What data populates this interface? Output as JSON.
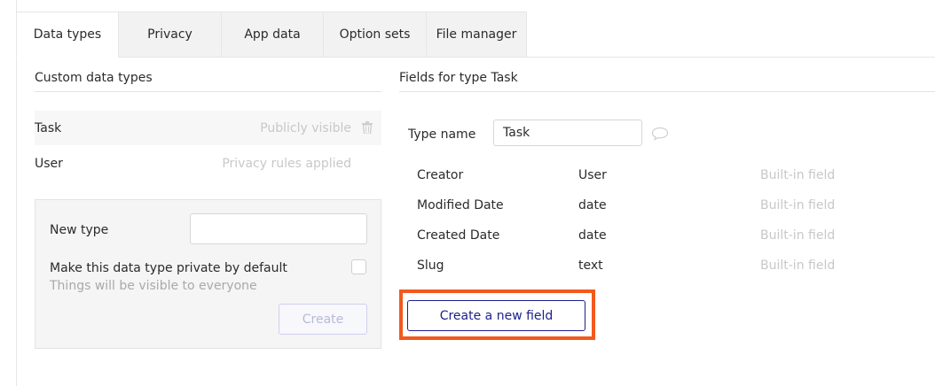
{
  "tabs": [
    {
      "label": "Data types",
      "active": true
    },
    {
      "label": "Privacy",
      "active": false
    },
    {
      "label": "App data",
      "active": false
    },
    {
      "label": "Option sets",
      "active": false
    },
    {
      "label": "File manager",
      "active": false
    }
  ],
  "left": {
    "title": "Custom data types",
    "types": [
      {
        "name": "Task",
        "status": "Publicly visible",
        "icon": "trash-icon",
        "selected": true
      },
      {
        "name": "User",
        "status": "Privacy rules applied",
        "selected": false
      }
    ],
    "new_type": {
      "label": "New type",
      "value": "",
      "private_label": "Make this data type private by default",
      "private_hint": "Things will be visible to everyone",
      "private_checked": false,
      "create_label": "Create"
    }
  },
  "right": {
    "title": "Fields for type Task",
    "type_name_label": "Type name",
    "type_name_value": "Task",
    "comment_icon": "speech-bubble-icon",
    "fields": [
      {
        "name": "Creator",
        "type": "User",
        "kind": "Built-in field"
      },
      {
        "name": "Modified Date",
        "type": "date",
        "kind": "Built-in field"
      },
      {
        "name": "Created Date",
        "type": "date",
        "kind": "Built-in field"
      },
      {
        "name": "Slug",
        "type": "text",
        "kind": "Built-in field"
      }
    ],
    "create_field_label": "Create a new field"
  },
  "colors": {
    "accent": "#1d1f8a",
    "highlight": "#f2591e",
    "muted": "#c8c8c8"
  }
}
